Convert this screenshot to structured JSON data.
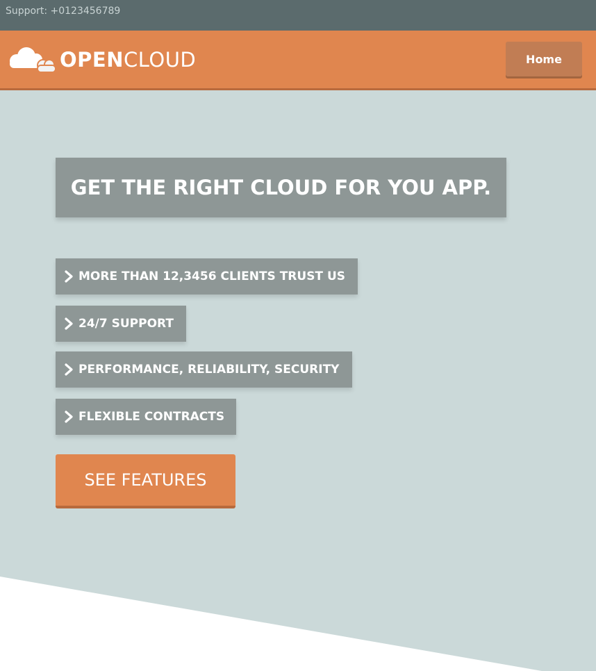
{
  "topbar": {
    "support_text": "Support: +0123456789"
  },
  "brand": {
    "name_bold": "OPEN",
    "name_light": "CLOUD",
    "icon": "cloud-logo"
  },
  "nav": {
    "home_label": "Home"
  },
  "hero": {
    "headline": "GET THE RIGHT CLOUD FOR YOU APP.",
    "features": [
      "MORE THAN 12,3456 CLIENTS TRUST US",
      "24/7 SUPPORT",
      "PERFORMANCE, RELIABILITY, SECURITY",
      "FLEXIBLE CONTRACTS"
    ],
    "cta_label": "SEE FEATURES"
  },
  "colors": {
    "topbar": "#5b6b6d",
    "accent": "#e0864f",
    "hero_bg": "#cbd9d9",
    "box_gray": "#8e9796"
  }
}
